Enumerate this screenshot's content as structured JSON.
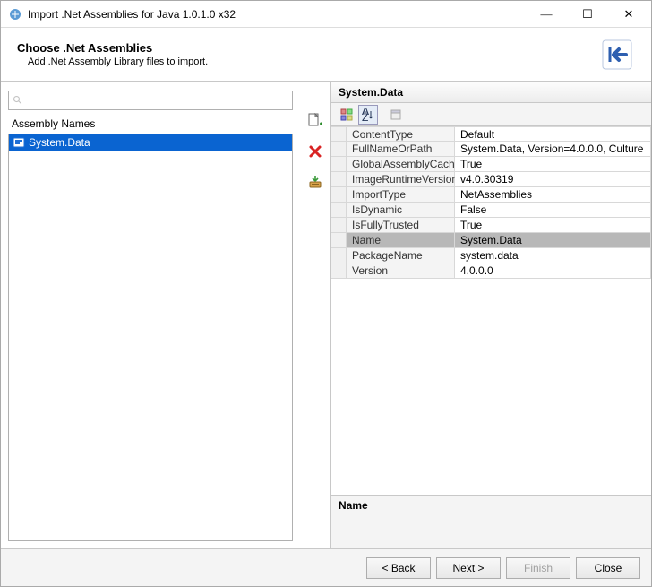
{
  "window": {
    "title": "Import .Net Assemblies for Java 1.0.1.0 x32"
  },
  "banner": {
    "heading": "Choose .Net Assemblies",
    "subtext": "Add .Net Assembly Library files to import."
  },
  "left": {
    "search_placeholder": "",
    "list_label": "Assembly Names",
    "items": [
      {
        "label": "System.Data",
        "selected": true
      }
    ]
  },
  "right": {
    "title": "System.Data",
    "properties": [
      {
        "name": "ContentType",
        "value": "Default"
      },
      {
        "name": "FullNameOrPath",
        "value": "System.Data, Version=4.0.0.0, Culture"
      },
      {
        "name": "GlobalAssemblyCache",
        "value": "True"
      },
      {
        "name": "ImageRuntimeVersion",
        "value": "v4.0.30319"
      },
      {
        "name": "ImportType",
        "value": "NetAssemblies"
      },
      {
        "name": "IsDynamic",
        "value": "False"
      },
      {
        "name": "IsFullyTrusted",
        "value": "True"
      },
      {
        "name": "Name",
        "value": "System.Data",
        "selected": true
      },
      {
        "name": "PackageName",
        "value": "system.data"
      },
      {
        "name": "Version",
        "value": "4.0.0.0"
      }
    ],
    "description_label": "Name"
  },
  "footer": {
    "back": "< Back",
    "next": "Next >",
    "finish": "Finish",
    "close": "Close"
  }
}
